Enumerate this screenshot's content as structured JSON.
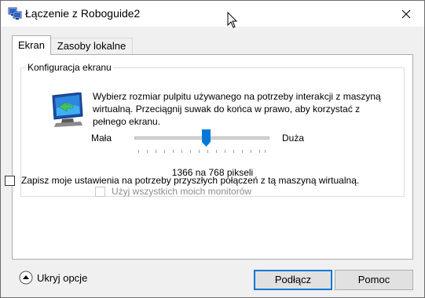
{
  "window": {
    "title": "Łączenie z Roboguide2"
  },
  "tabs": [
    {
      "label": "Ekran",
      "active": true
    },
    {
      "label": "Zasoby lokalne",
      "active": false
    }
  ],
  "display": {
    "group_title": "Konfiguracja ekranu",
    "description": "Wybierz rozmiar pulpitu używanego na potrzeby interakcji z maszyną wirtualną. Przeciągnij suwak do końca w prawo, aby korzystać z pełnego ekranu.",
    "slider_min_label": "Mała",
    "slider_max_label": "Duża",
    "resolution_text": "1366 na 768 pikseli",
    "all_monitors_label": "Użyj wszystkich moich monitorów",
    "all_monitors_checked": false,
    "all_monitors_enabled": false
  },
  "save_settings": {
    "label": "Zapisz moje ustawienia na potrzeby przyszłych połączeń z tą maszyną wirtualną.",
    "checked": false
  },
  "footer": {
    "hide_options_label": "Ukryj opcje",
    "connect_label": "Podłącz",
    "help_label": "Pomoc"
  },
  "colors": {
    "accent": "#0078d7",
    "slider_thumb": "#0078d7",
    "window_bg": "#f0f0f0"
  },
  "icons": {
    "app": "vm-connect-icon",
    "close": "close-icon",
    "monitor": "monitor-icon",
    "hide_options": "chevron-up-circle-icon"
  }
}
